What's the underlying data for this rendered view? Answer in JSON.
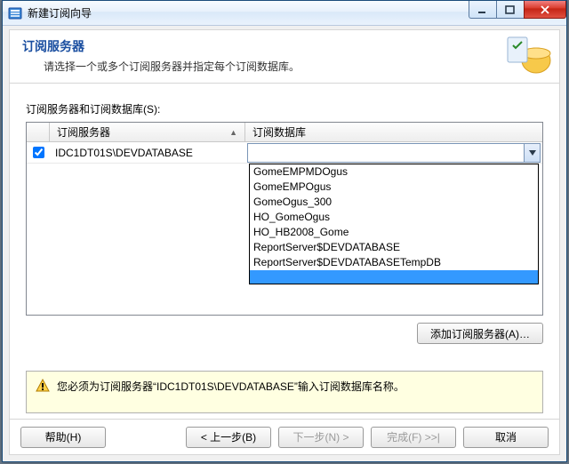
{
  "window": {
    "title": "新建订阅向导"
  },
  "header": {
    "title": "订阅服务器",
    "subtitle": "请选择一个或多个订阅服务器并指定每个订阅数据库。"
  },
  "grid": {
    "label": "订阅服务器和订阅数据库(S):",
    "col_server": "订阅服务器",
    "col_db": "订阅数据库",
    "row": {
      "checked": true,
      "server": "IDC1DT01S\\DEVDATABASE",
      "db_value": ""
    },
    "dropdown": [
      "GomeEMPMDOgus",
      "GomeEMPOgus",
      "GomeOgus_300",
      "HO_GomeOgus",
      "HO_HB2008_Gome",
      "ReportServer$DEVDATABASE",
      "ReportServer$DEVDATABASETempDB"
    ]
  },
  "buttons": {
    "add_server": "添加订阅服务器(A)…",
    "help": "帮助(H)",
    "back": "< 上一步(B)",
    "next": "下一步(N) >",
    "finish": "完成(F) >>|",
    "cancel": "取消"
  },
  "warning": {
    "text": "您必须为订阅服务器“IDC1DT01S\\DEVDATABASE”输入订阅数据库名称。"
  }
}
